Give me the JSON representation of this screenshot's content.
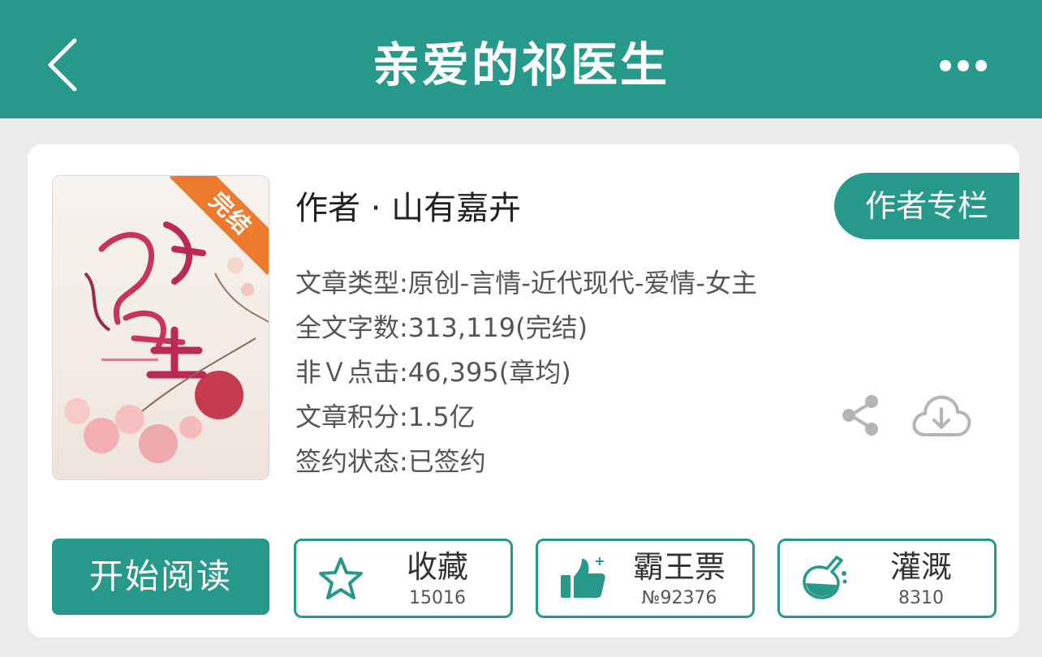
{
  "header": {
    "title": "亲爱的祁医生",
    "back_icon": "chevron-left-icon",
    "more_icon": "more-dots-icon",
    "color": "#26998a"
  },
  "book": {
    "cover_badge": "完结",
    "author_line": "作者 · 山有嘉卉",
    "author_column_button": "作者专栏",
    "meta": [
      "文章类型:原创-言情-近代现代-爱情-女主",
      "全文字数:313,119(完结)",
      "非Ｖ点击:46,395(章均)",
      "文章积分:1.5亿",
      "签约状态:已签约"
    ],
    "share_icon": "share-icon",
    "download_icon": "cloud-download-icon"
  },
  "actions": {
    "read_button": "开始阅读",
    "favorite": {
      "label": "收藏",
      "count": "15016",
      "icon": "star-outline-icon"
    },
    "overlord": {
      "label": "霸王票",
      "count": "№92376",
      "icon": "thumbs-up-icon"
    },
    "irrigate": {
      "label": "灌溉",
      "count": "8310",
      "icon": "flask-icon"
    }
  },
  "colors": {
    "accent": "#26998a",
    "badge": "#ee7a2d",
    "background": "#ebebeb"
  }
}
